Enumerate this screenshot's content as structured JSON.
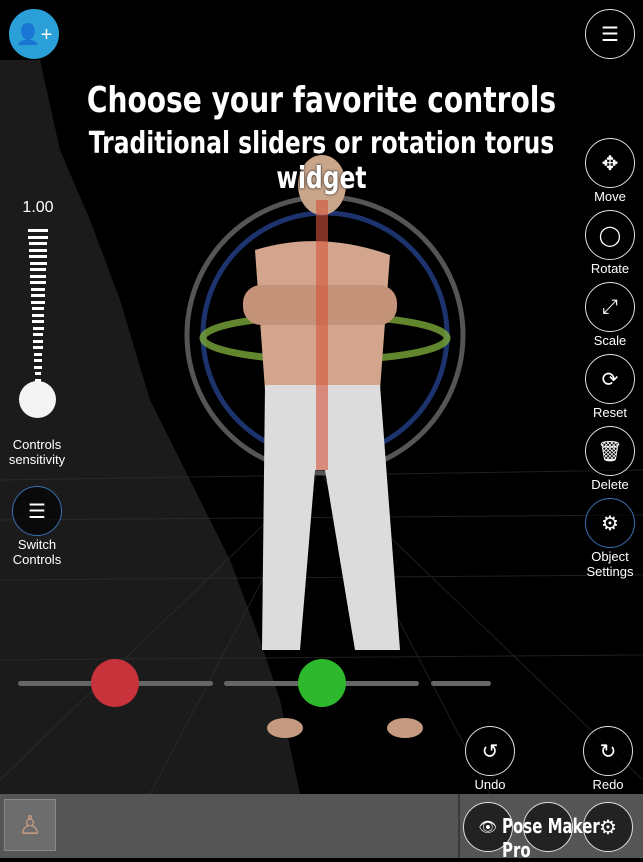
{
  "header": {
    "add_figure_icon": "person-plus-icon",
    "menu_icon": "hamburger-icon"
  },
  "banner": {
    "line1": "Choose your favorite controls",
    "line2": "Traditional sliders or rotation torus widget"
  },
  "sensitivity": {
    "value_label": "1.00",
    "value": 1.0,
    "label": "Controls sensitivity"
  },
  "switch_controls": {
    "label": "Switch Controls"
  },
  "right_tools": [
    {
      "label": "Move",
      "icon": "move-arrows-icon",
      "glyph": "✥"
    },
    {
      "label": "Rotate",
      "icon": "rotate-icon",
      "glyph": "◯"
    },
    {
      "label": "Scale",
      "icon": "scale-arrows-icon",
      "glyph": "⤢"
    },
    {
      "label": "Reset",
      "icon": "refresh-icon",
      "glyph": "⟳"
    },
    {
      "label": "Delete",
      "icon": "trash-icon",
      "glyph": "🗑"
    },
    {
      "label": "Object Settings",
      "icon": "person-gear-icon",
      "glyph": "⚙"
    }
  ],
  "history": {
    "undo": "Undo",
    "redo": "Redo"
  },
  "colors": {
    "red_knob": "#c8323a",
    "green_knob": "#2eb82e",
    "accent_ring": "#3a6fb0"
  },
  "watermark": "Pose Maker Pro"
}
